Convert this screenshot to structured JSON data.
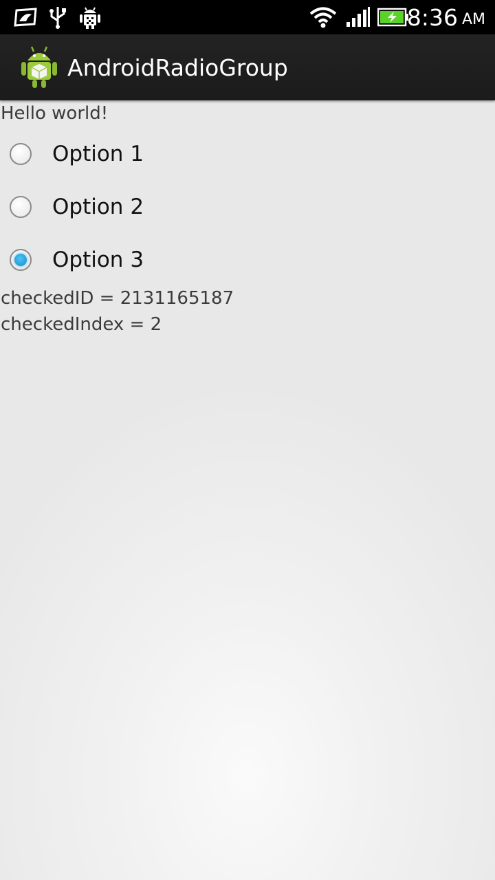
{
  "status_bar": {
    "time": "8:36",
    "ampm": "AM",
    "icons": [
      "photo-icon",
      "usb-icon",
      "android-debug-icon",
      "wifi-icon",
      "signal-icon",
      "battery-icon"
    ]
  },
  "action_bar": {
    "title": "AndroidRadioGroup",
    "icon": "android-app-icon"
  },
  "content": {
    "hello": "Hello world!",
    "radio_group": {
      "options": [
        {
          "label": "Option 1",
          "checked": false
        },
        {
          "label": "Option 2",
          "checked": false
        },
        {
          "label": "Option 3",
          "checked": true
        }
      ]
    },
    "checked_id_text": "checkedID = 2131165187",
    "checked_index_text": "checkedIndex = 2"
  },
  "colors": {
    "status_bar_bg": "#000000",
    "action_bar_bg": "#1f1f1f",
    "radio_accent": "#1a9ad6",
    "battery_green": "#5bd22a"
  }
}
